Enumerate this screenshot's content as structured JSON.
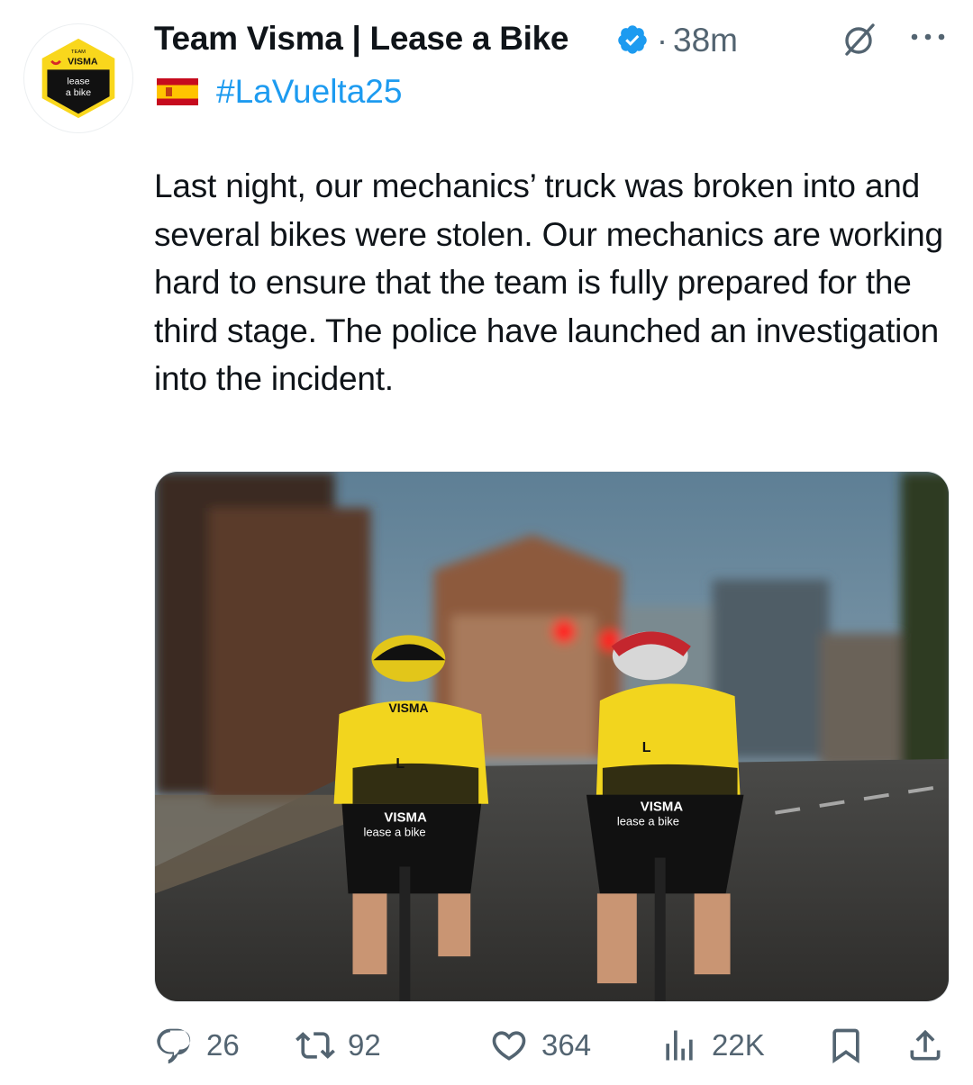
{
  "author": {
    "display_name": "Team Visma | Lease a Bike",
    "verified_icon": "verified-badge-icon",
    "separator": "·",
    "time": "38m",
    "avatar": {
      "top_text": "TEAM",
      "brand": "VISMA",
      "line1": "lease",
      "line2": "a bike",
      "colors": {
        "yellow": "#f9d71c",
        "black": "#111111"
      }
    }
  },
  "subline": {
    "flag_icon": "spain-flag-icon",
    "hashtag": "#LaVuelta25"
  },
  "tweet": {
    "text": "Last night, our mechanics’ truck was broken into and several bikes were stolen. Our mechanics are working hard to ensure that the team is fully prepared for the third stage. The police have launched an investigation into the incident."
  },
  "media": {
    "jersey_left": {
      "brand": "VISMA",
      "sub": "lease a bike",
      "size": "L"
    },
    "jersey_right": {
      "brand": "VISMA",
      "sub": "lease a bike",
      "size": "L"
    }
  },
  "actions": {
    "replies": "26",
    "reposts": "92",
    "likes": "364",
    "views": "22K"
  },
  "colors": {
    "accent": "#1d9bf0",
    "muted": "#536471",
    "text": "#0f1419"
  }
}
